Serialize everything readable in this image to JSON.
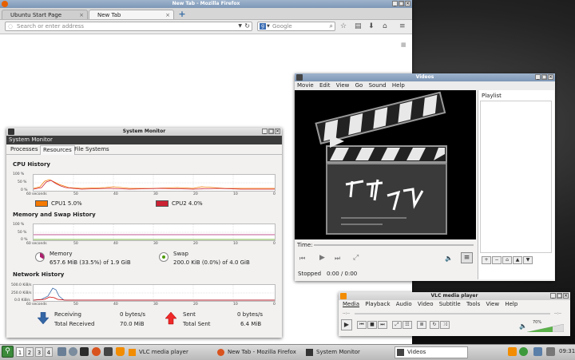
{
  "firefox": {
    "title": "New Tab - Mozilla Firefox",
    "tabs": [
      "Ubuntu Start Page",
      "New Tab"
    ],
    "url_placeholder": "Search or enter address",
    "search_placeholder": "Google"
  },
  "sysmon": {
    "title": "System Monitor",
    "header": "System Monitor",
    "tabs": [
      "Processes",
      "Resources",
      "File Systems"
    ],
    "cpu": {
      "heading": "CPU History",
      "y_ticks": [
        "100 %",
        "50 %",
        "0 %"
      ],
      "x_ticks": [
        "60 seconds",
        "50",
        "40",
        "30",
        "20",
        "10",
        "0"
      ],
      "cpu1": "CPU1 5.0%",
      "cpu2": "CPU2 4.0%",
      "cpu1_color": "#f57900",
      "cpu2_color": "#cc2233"
    },
    "mem": {
      "heading": "Memory and Swap History",
      "y_ticks": [
        "100 %",
        "50 %",
        "0 %"
      ],
      "x_ticks": [
        "60 seconds",
        "50",
        "40",
        "30",
        "20",
        "10",
        "0"
      ],
      "memory_label": "Memory",
      "memory_value": "657.6 MiB (33.5%) of 1.9 GiB",
      "swap_label": "Swap",
      "swap_value": "200.0 KiB (0.0%) of 4.0 GiB"
    },
    "net": {
      "heading": "Network History",
      "y_ticks": [
        "500.0 KiB/s",
        "250.0 KiB/s",
        "0.0 KiB/s"
      ],
      "x_ticks": [
        "60 seconds",
        "50",
        "40",
        "30",
        "20",
        "10",
        "0"
      ],
      "receiving_label": "Receiving",
      "receiving_value": "0 bytes/s",
      "total_received_label": "Total Received",
      "total_received_value": "70.0 MiB",
      "sent_label": "Sent",
      "sent_value": "0 bytes/s",
      "total_sent_label": "Total Sent",
      "total_sent_value": "6.4 MiB"
    }
  },
  "videos": {
    "title": "Videos",
    "menu": [
      "Movie",
      "Edit",
      "View",
      "Go",
      "Sound",
      "Help"
    ],
    "playlist_label": "Playlist",
    "time_label": "Time:",
    "status": "Stopped",
    "time_value": "0:00 / 0:00"
  },
  "vlc": {
    "title": "VLC media player",
    "menu": [
      "Media",
      "Playback",
      "Audio",
      "Video",
      "Subtitle",
      "Tools",
      "View",
      "Help"
    ],
    "time_left": "--:--",
    "time_right": "--:--",
    "volume": "70%"
  },
  "taskbar": {
    "workspaces": [
      "1",
      "2",
      "3",
      "4"
    ],
    "tasks": [
      "VLC media player",
      "New Tab - Mozilla Firefox",
      "System Monitor",
      "Videos"
    ],
    "clock": "09:31"
  }
}
